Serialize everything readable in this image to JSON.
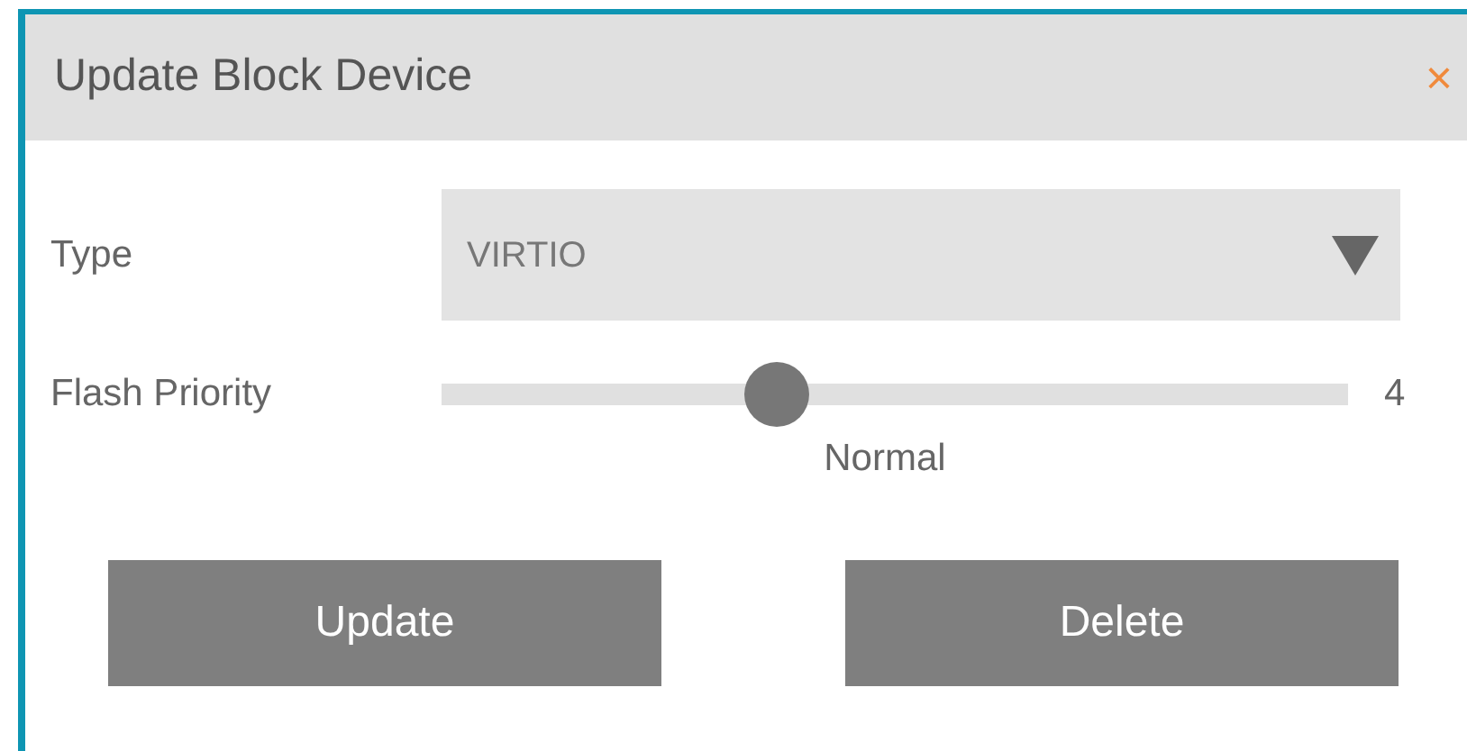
{
  "dialog": {
    "title": "Update Block Device",
    "close": "×"
  },
  "fields": [
    {
      "kind": "select",
      "label": "Type",
      "value": "VIRTIO"
    },
    {
      "kind": "slider",
      "label": "Flash Priority",
      "level": 0.37,
      "reading": "4",
      "caption": "Normal"
    }
  ],
  "buttons": [
    "Update",
    "Delete"
  ]
}
